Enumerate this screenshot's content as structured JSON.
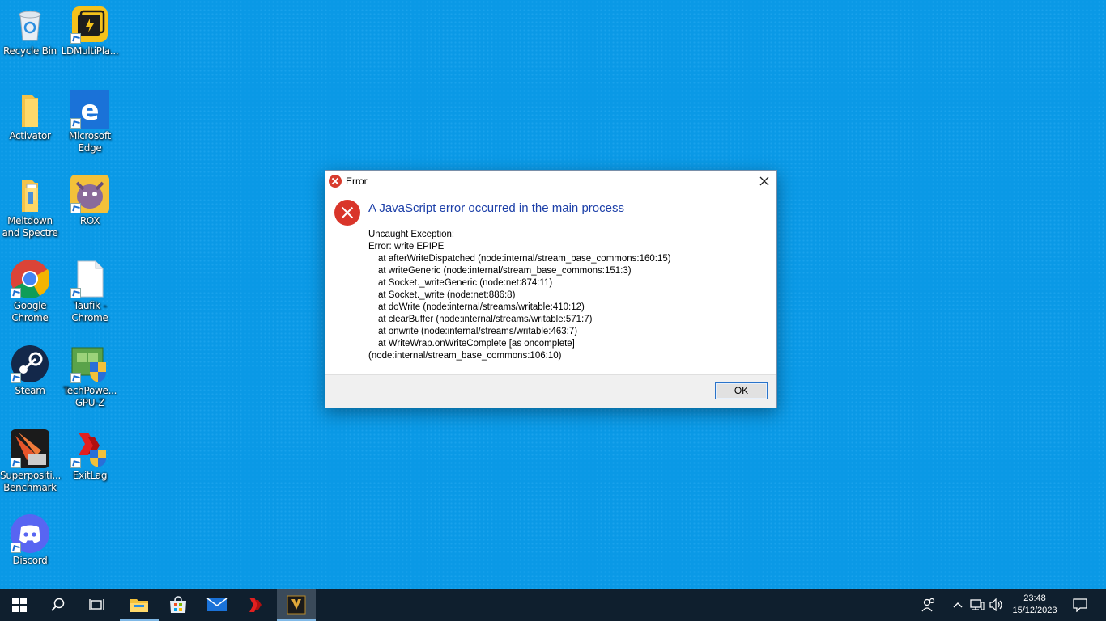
{
  "desktop": {
    "icons": [
      {
        "label": "Recycle Bin",
        "icon": "recycle-bin-icon"
      },
      {
        "label": "LDMultiPla...",
        "icon": "ldmultiplayer-icon"
      },
      {
        "label": "Activator",
        "icon": "folder-icon"
      },
      {
        "label": "Microsoft Edge",
        "icon": "edge-icon"
      },
      {
        "label": "Meltdown and Spectre",
        "icon": "folder-doc-icon"
      },
      {
        "label": "ROX",
        "icon": "rox-icon"
      },
      {
        "label": "Google Chrome",
        "icon": "chrome-icon"
      },
      {
        "label": "Taufik - Chrome",
        "icon": "file-icon"
      },
      {
        "label": "Steam",
        "icon": "steam-icon"
      },
      {
        "label": "TechPowe... GPU-Z",
        "icon": "gpuz-icon"
      },
      {
        "label": "Superpositi... Benchmark",
        "icon": "superposition-icon"
      },
      {
        "label": "ExitLag",
        "icon": "exitlag-icon"
      },
      {
        "label": "Discord",
        "icon": "discord-icon"
      }
    ]
  },
  "dialog": {
    "title": "Error",
    "main_instruction": "A JavaScript error occurred in the main process",
    "lines": [
      "Uncaught Exception:",
      "Error: write EPIPE",
      "at afterWriteDispatched (node:internal/stream_base_commons:160:15)",
      "at writeGeneric (node:internal/stream_base_commons:151:3)",
      "at Socket._writeGeneric (node:net:874:11)",
      "at Socket._write (node:net:886:8)",
      "at doWrite (node:internal/streams/writable:410:12)",
      "at clearBuffer (node:internal/streams/writable:571:7)",
      "at onwrite (node:internal/streams/writable:463:7)",
      "at WriteWrap.onWriteComplete [as oncomplete]",
      "(node:internal/stream_base_commons:106:10)"
    ],
    "ok_label": "OK"
  },
  "taskbar": {
    "clock_time": "23:48",
    "clock_date": "15/12/2023"
  },
  "colors": {
    "desktop_bg": "#0a99e6",
    "taskbar_bg": "#0f1f2e",
    "error_red": "#d9352a",
    "instruction_blue": "#1c3fa8"
  }
}
